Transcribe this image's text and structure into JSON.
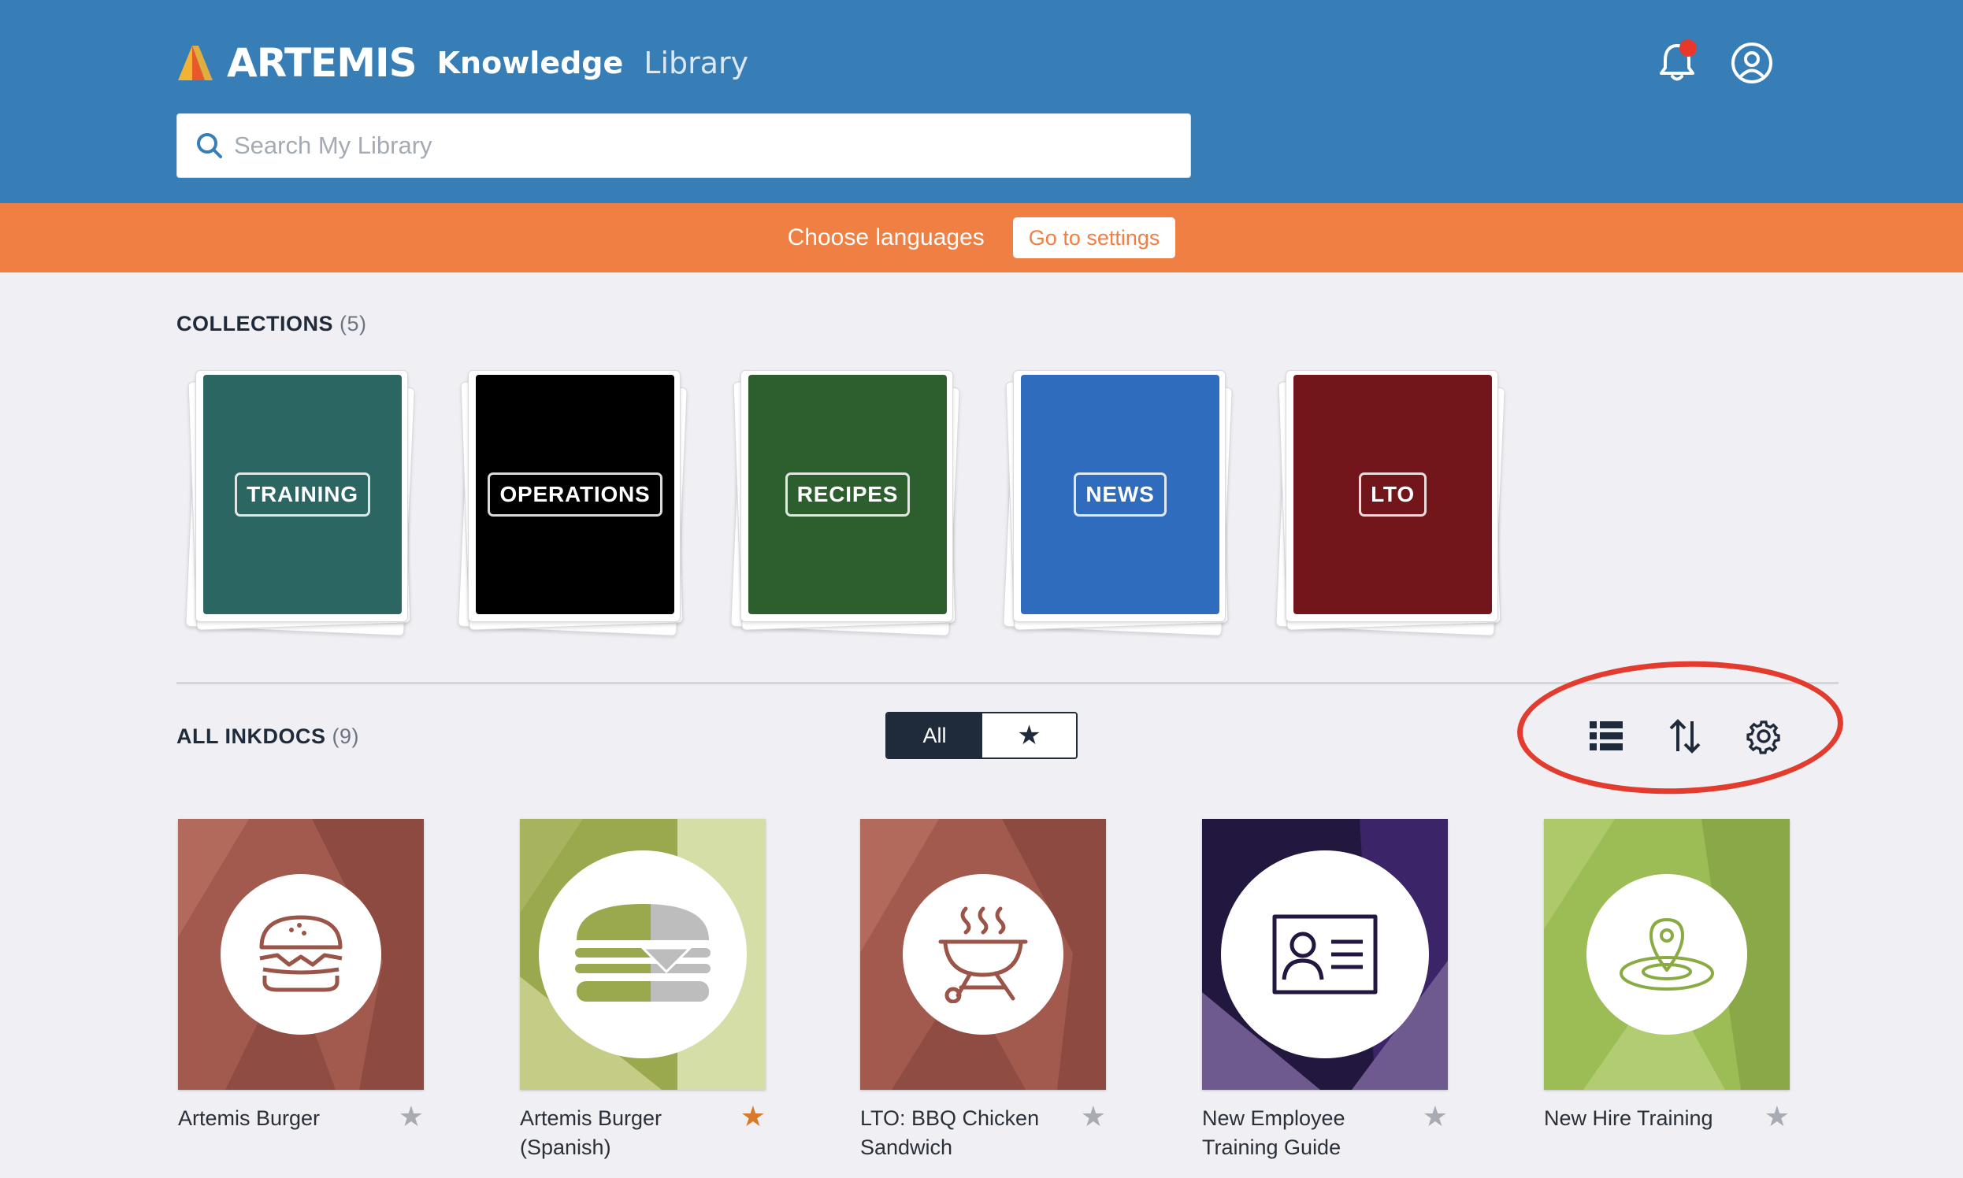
{
  "header": {
    "brand": "ARTEMIS",
    "app_name": "Knowledge",
    "app_sub": "Library",
    "search_placeholder": "Search My Library"
  },
  "banner": {
    "text": "Choose languages",
    "button_label": "Go to settings"
  },
  "collections": {
    "heading": "COLLECTIONS",
    "count": "(5)",
    "items": [
      {
        "label": "TRAINING",
        "color": "#2c6662"
      },
      {
        "label": "OPERATIONS",
        "color": "#000000"
      },
      {
        "label": "RECIPES",
        "color": "#2d5f2e"
      },
      {
        "label": "NEWS",
        "color": "#2f6cbd"
      },
      {
        "label": "LTO",
        "color": "#72161c"
      }
    ]
  },
  "inkdocs": {
    "heading": "ALL INKDOCS",
    "count": "(9)",
    "filter": {
      "all_label": "All",
      "favorites_icon": "star-icon",
      "selected": "All"
    },
    "tools": [
      "list-view-icon",
      "sort-icon",
      "settings-gear-icon"
    ],
    "items": [
      {
        "title": "Artemis Burger",
        "favorited": false,
        "icon": "burger-icon"
      },
      {
        "title": "Artemis Burger (Spanish)",
        "favorited": true,
        "icon": "burger-icon"
      },
      {
        "title": "LTO: BBQ Chicken Sandwich",
        "favorited": false,
        "icon": "grill-icon"
      },
      {
        "title": "New Employee Training Guide",
        "favorited": false,
        "icon": "id-card-icon"
      },
      {
        "title": "New Hire Training",
        "favorited": false,
        "icon": "location-pin-icon"
      }
    ]
  },
  "colors": {
    "header": "#377db6",
    "banner": "#f07f43",
    "favorite_star": "#d9792a",
    "unfavorite_star": "#a9abb2",
    "highlight": "#e33b2e"
  }
}
